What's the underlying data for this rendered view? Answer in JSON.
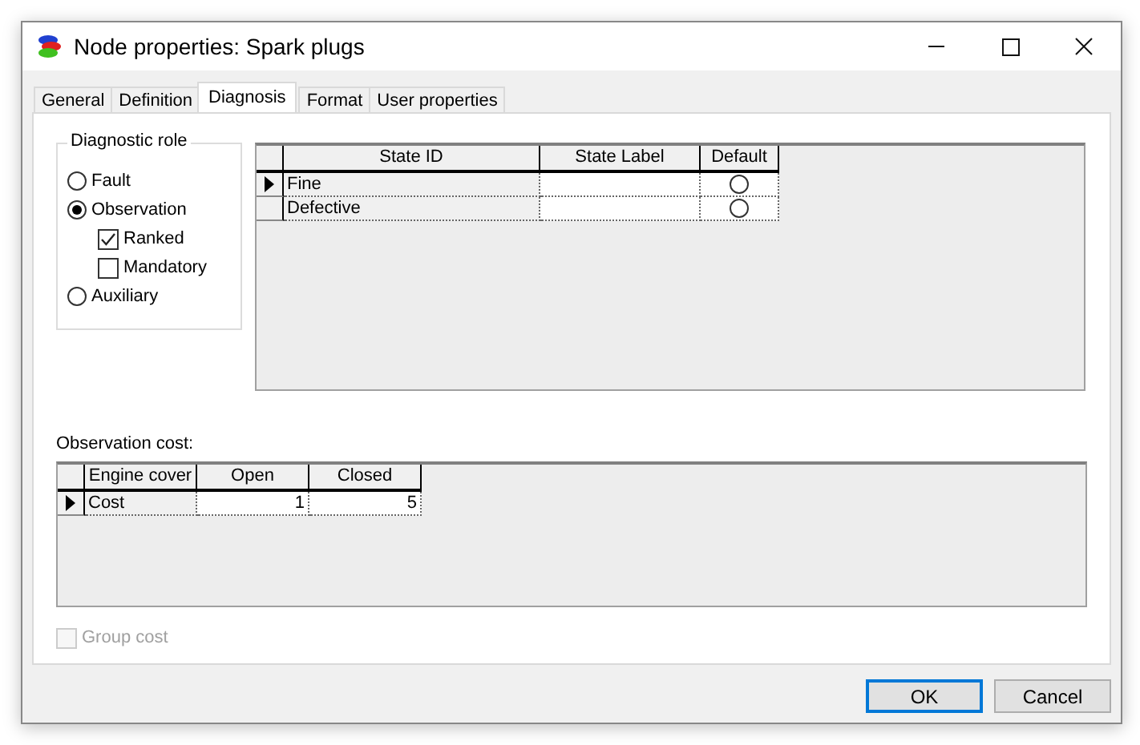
{
  "window": {
    "title": "Node properties: Spark plugs"
  },
  "tabs": [
    {
      "label": "General",
      "selected": false
    },
    {
      "label": "Definition",
      "selected": false
    },
    {
      "label": "Diagnosis",
      "selected": true
    },
    {
      "label": "Format",
      "selected": false
    },
    {
      "label": "User properties",
      "selected": false
    }
  ],
  "diagnostic_role": {
    "title": "Diagnostic role",
    "options": [
      {
        "label": "Fault",
        "selected": false
      },
      {
        "label": "Observation",
        "selected": true,
        "children": [
          {
            "label": "Ranked",
            "checked": true
          },
          {
            "label": "Mandatory",
            "checked": false
          }
        ]
      },
      {
        "label": "Auxiliary",
        "selected": false
      }
    ]
  },
  "states_table": {
    "columns": [
      "State ID",
      "State Label",
      "Default"
    ],
    "rows": [
      {
        "state_id": "Fine",
        "current": true,
        "default": false
      },
      {
        "state_id": "Defective",
        "current": false,
        "default": false
      }
    ]
  },
  "observation_cost": {
    "label": "Observation cost:",
    "columns": [
      "Engine cover",
      "Open",
      "Closed"
    ],
    "rows": [
      {
        "cells": [
          "Cost",
          "1",
          "5"
        ],
        "current": true
      }
    ]
  },
  "group_cost": {
    "label": "Group cost",
    "checked": false,
    "disabled": true
  },
  "buttons": [
    {
      "label": "OK",
      "default": true
    },
    {
      "label": "Cancel",
      "default": false
    }
  ]
}
